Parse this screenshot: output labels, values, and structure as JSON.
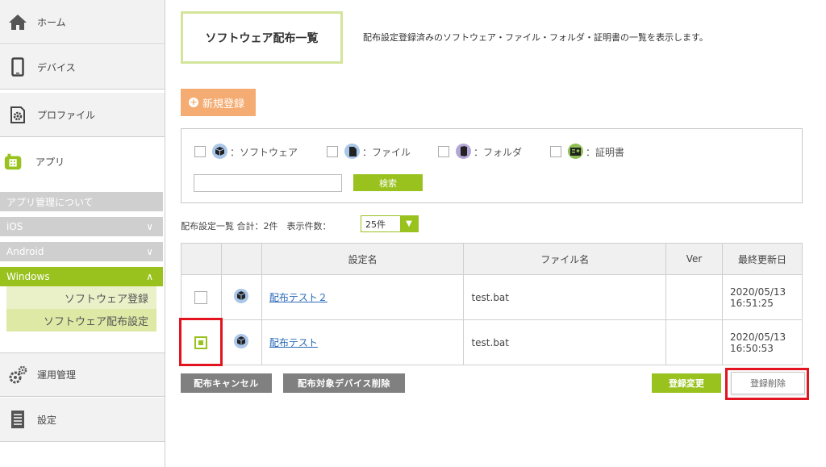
{
  "sidebar": {
    "home": "ホーム",
    "device": "デバイス",
    "profile": "プロファイル",
    "app": "アプリ",
    "app_about": "アプリ管理について",
    "ios": "iOS",
    "android": "Android",
    "windows": "Windows",
    "software_register": "ソフトウェア登録",
    "software_dist": "ソフトウェア配布設定",
    "operation": "運用管理",
    "settings": "設定",
    "chevron_down": "∨",
    "chevron_up": "∧"
  },
  "page": {
    "title": "ソフトウェア配布一覧",
    "description": "配布設定登録済みのソフトウェア・ファイル・フォルダ・証明書の一覧を表示します。",
    "new_button": "新規登録"
  },
  "filter": {
    "software": "：ソフトウェア",
    "file": "：ファイル",
    "folder": "：フォルダ",
    "certificate": "：証明書",
    "search_value": "",
    "search_button": "検索"
  },
  "list": {
    "summary": "配布設定一覧 合計：2件　表示件数：",
    "per_page": "25件",
    "headers": [
      "設定名",
      "ファイル名",
      "Ver",
      "最終更新日"
    ],
    "rows": [
      {
        "name": "配布テスト２",
        "file": "test.bat",
        "ver": "",
        "date": "2020/05/13",
        "time": "16:51:25",
        "checked": false
      },
      {
        "name": "配布テスト",
        "file": "test.bat",
        "ver": "",
        "date": "2020/05/13",
        "time": "16:50:53",
        "checked": true
      }
    ]
  },
  "actions": {
    "cancel": "配布キャンセル",
    "delete_devices": "配布対象デバイス削除",
    "edit": "登録変更",
    "delete": "登録削除"
  },
  "colors": {
    "accent_green": "#99c21f",
    "orange": "#f5ac72",
    "highlight_red": "#e2141f"
  }
}
